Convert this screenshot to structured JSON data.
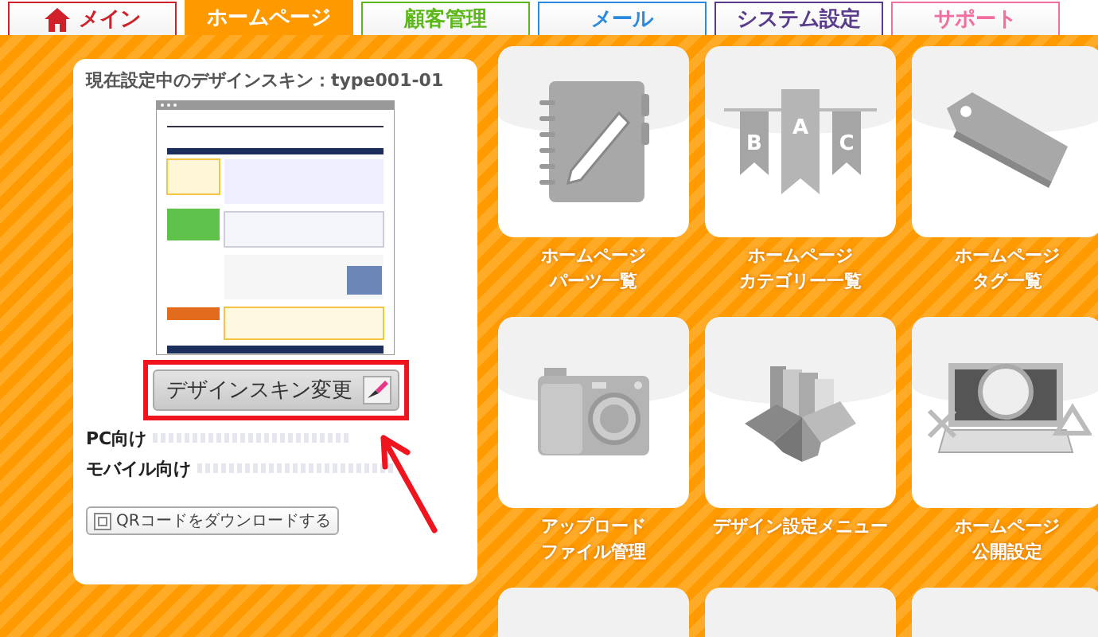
{
  "tabs": [
    {
      "label": "メイン",
      "selected": false,
      "color": "#d0202a",
      "kind": "home"
    },
    {
      "label": "ホームページ",
      "selected": true,
      "color": "#ff9900",
      "kind": "plain"
    },
    {
      "label": "顧客管理",
      "selected": false,
      "color": "#5cb81a",
      "kind": "plain"
    },
    {
      "label": "メール",
      "selected": false,
      "color": "#2a8ae0",
      "kind": "plain"
    },
    {
      "label": "システム設定",
      "selected": false,
      "color": "#5a3c8c",
      "kind": "plain"
    },
    {
      "label": "サポート",
      "selected": false,
      "color": "#f06fa0",
      "kind": "plain"
    }
  ],
  "skin_panel": {
    "title": "現在設定中のデザインスキン：type001-01",
    "change_button": "デザインスキン変更",
    "highlighted": true,
    "urls": [
      {
        "label": "PC向け"
      },
      {
        "label": "モバイル向け"
      }
    ],
    "qr_button": "QRコードをダウンロードする"
  },
  "tiles": [
    {
      "kind": "notebook",
      "lines": [
        "ホームページ",
        "パーツ一覧"
      ]
    },
    {
      "kind": "banners",
      "lines": [
        "ホームページ",
        "カテゴリー一覧"
      ],
      "letters": [
        "B",
        "A",
        "C"
      ]
    },
    {
      "kind": "tag",
      "lines": [
        "ホームページ",
        "タグ一覧"
      ]
    },
    {
      "kind": "camera",
      "lines": [
        "アップロード",
        "ファイル管理"
      ]
    },
    {
      "kind": "box",
      "lines": [
        "デザイン設定メニュー"
      ]
    },
    {
      "kind": "laptop",
      "lines": [
        "ホームページ",
        "公開設定"
      ]
    },
    {
      "kind": "partial"
    },
    {
      "kind": "partial"
    },
    {
      "kind": "partial"
    }
  ]
}
